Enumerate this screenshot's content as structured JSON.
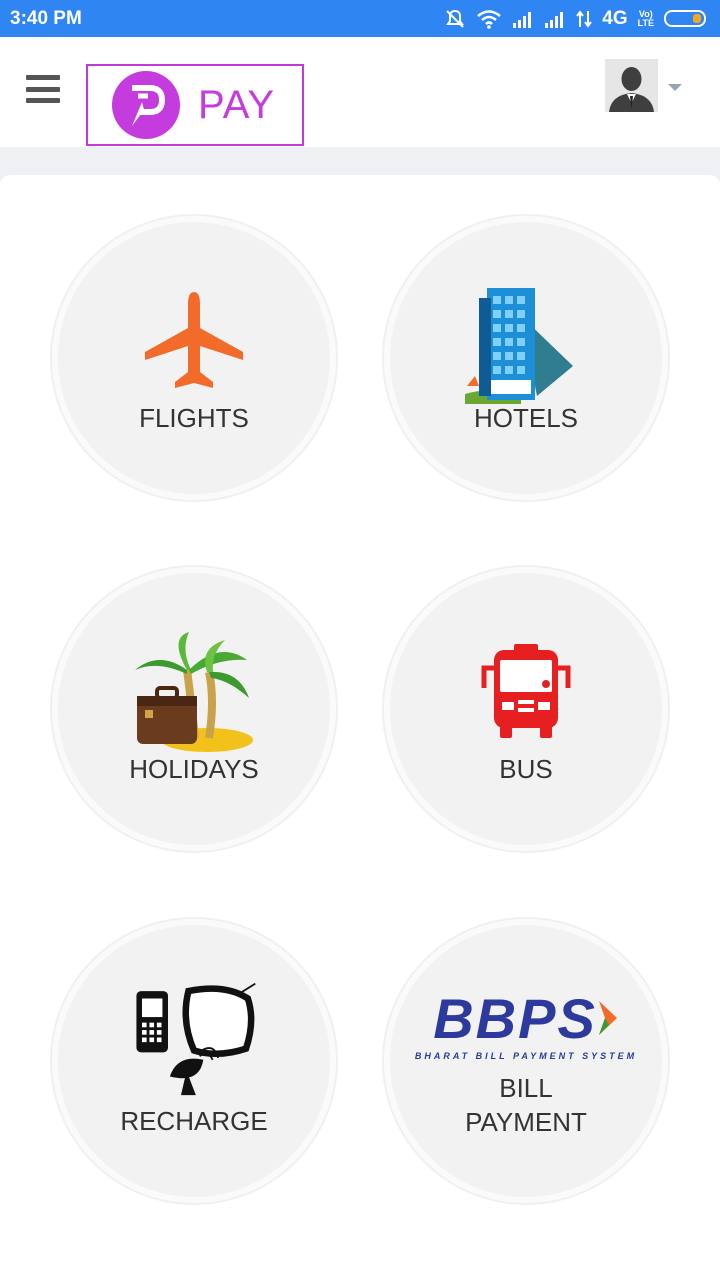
{
  "status_bar": {
    "time": "3:40 PM",
    "network": "4G",
    "volte_line1": "Vo)",
    "volte_line2": "LTE",
    "icons": [
      "mute-icon",
      "wifi-icon",
      "signal-icon",
      "signal-icon",
      "data-arrows-icon",
      "battery-icon"
    ]
  },
  "header": {
    "logo_text": "PAY",
    "menu_icon": "hamburger-icon",
    "profile_icon": "user-avatar"
  },
  "services": [
    {
      "label": "FLIGHTS",
      "icon": "airplane-icon"
    },
    {
      "label": "HOTELS",
      "icon": "hotel-building-icon"
    },
    {
      "label": "HOLIDAYS",
      "icon": "palm-tree-luggage-icon"
    },
    {
      "label": "BUS",
      "icon": "bus-icon"
    },
    {
      "label": "RECHARGE",
      "icon": "phone-tv-dish-icon"
    },
    {
      "label": "BILL\nPAYMENT",
      "label_line1": "BILL",
      "label_line2": "PAYMENT",
      "icon": "bbps-logo"
    }
  ],
  "bbps": {
    "name": "BBPS",
    "tagline": "BHARAT BILL PAYMENT SYSTEM"
  },
  "colors": {
    "status_bar": "#2f86f2",
    "brand": "#c43cde",
    "flight": "#f26b2a",
    "bus": "#e62020",
    "bbps_blue": "#2b3a9c"
  }
}
